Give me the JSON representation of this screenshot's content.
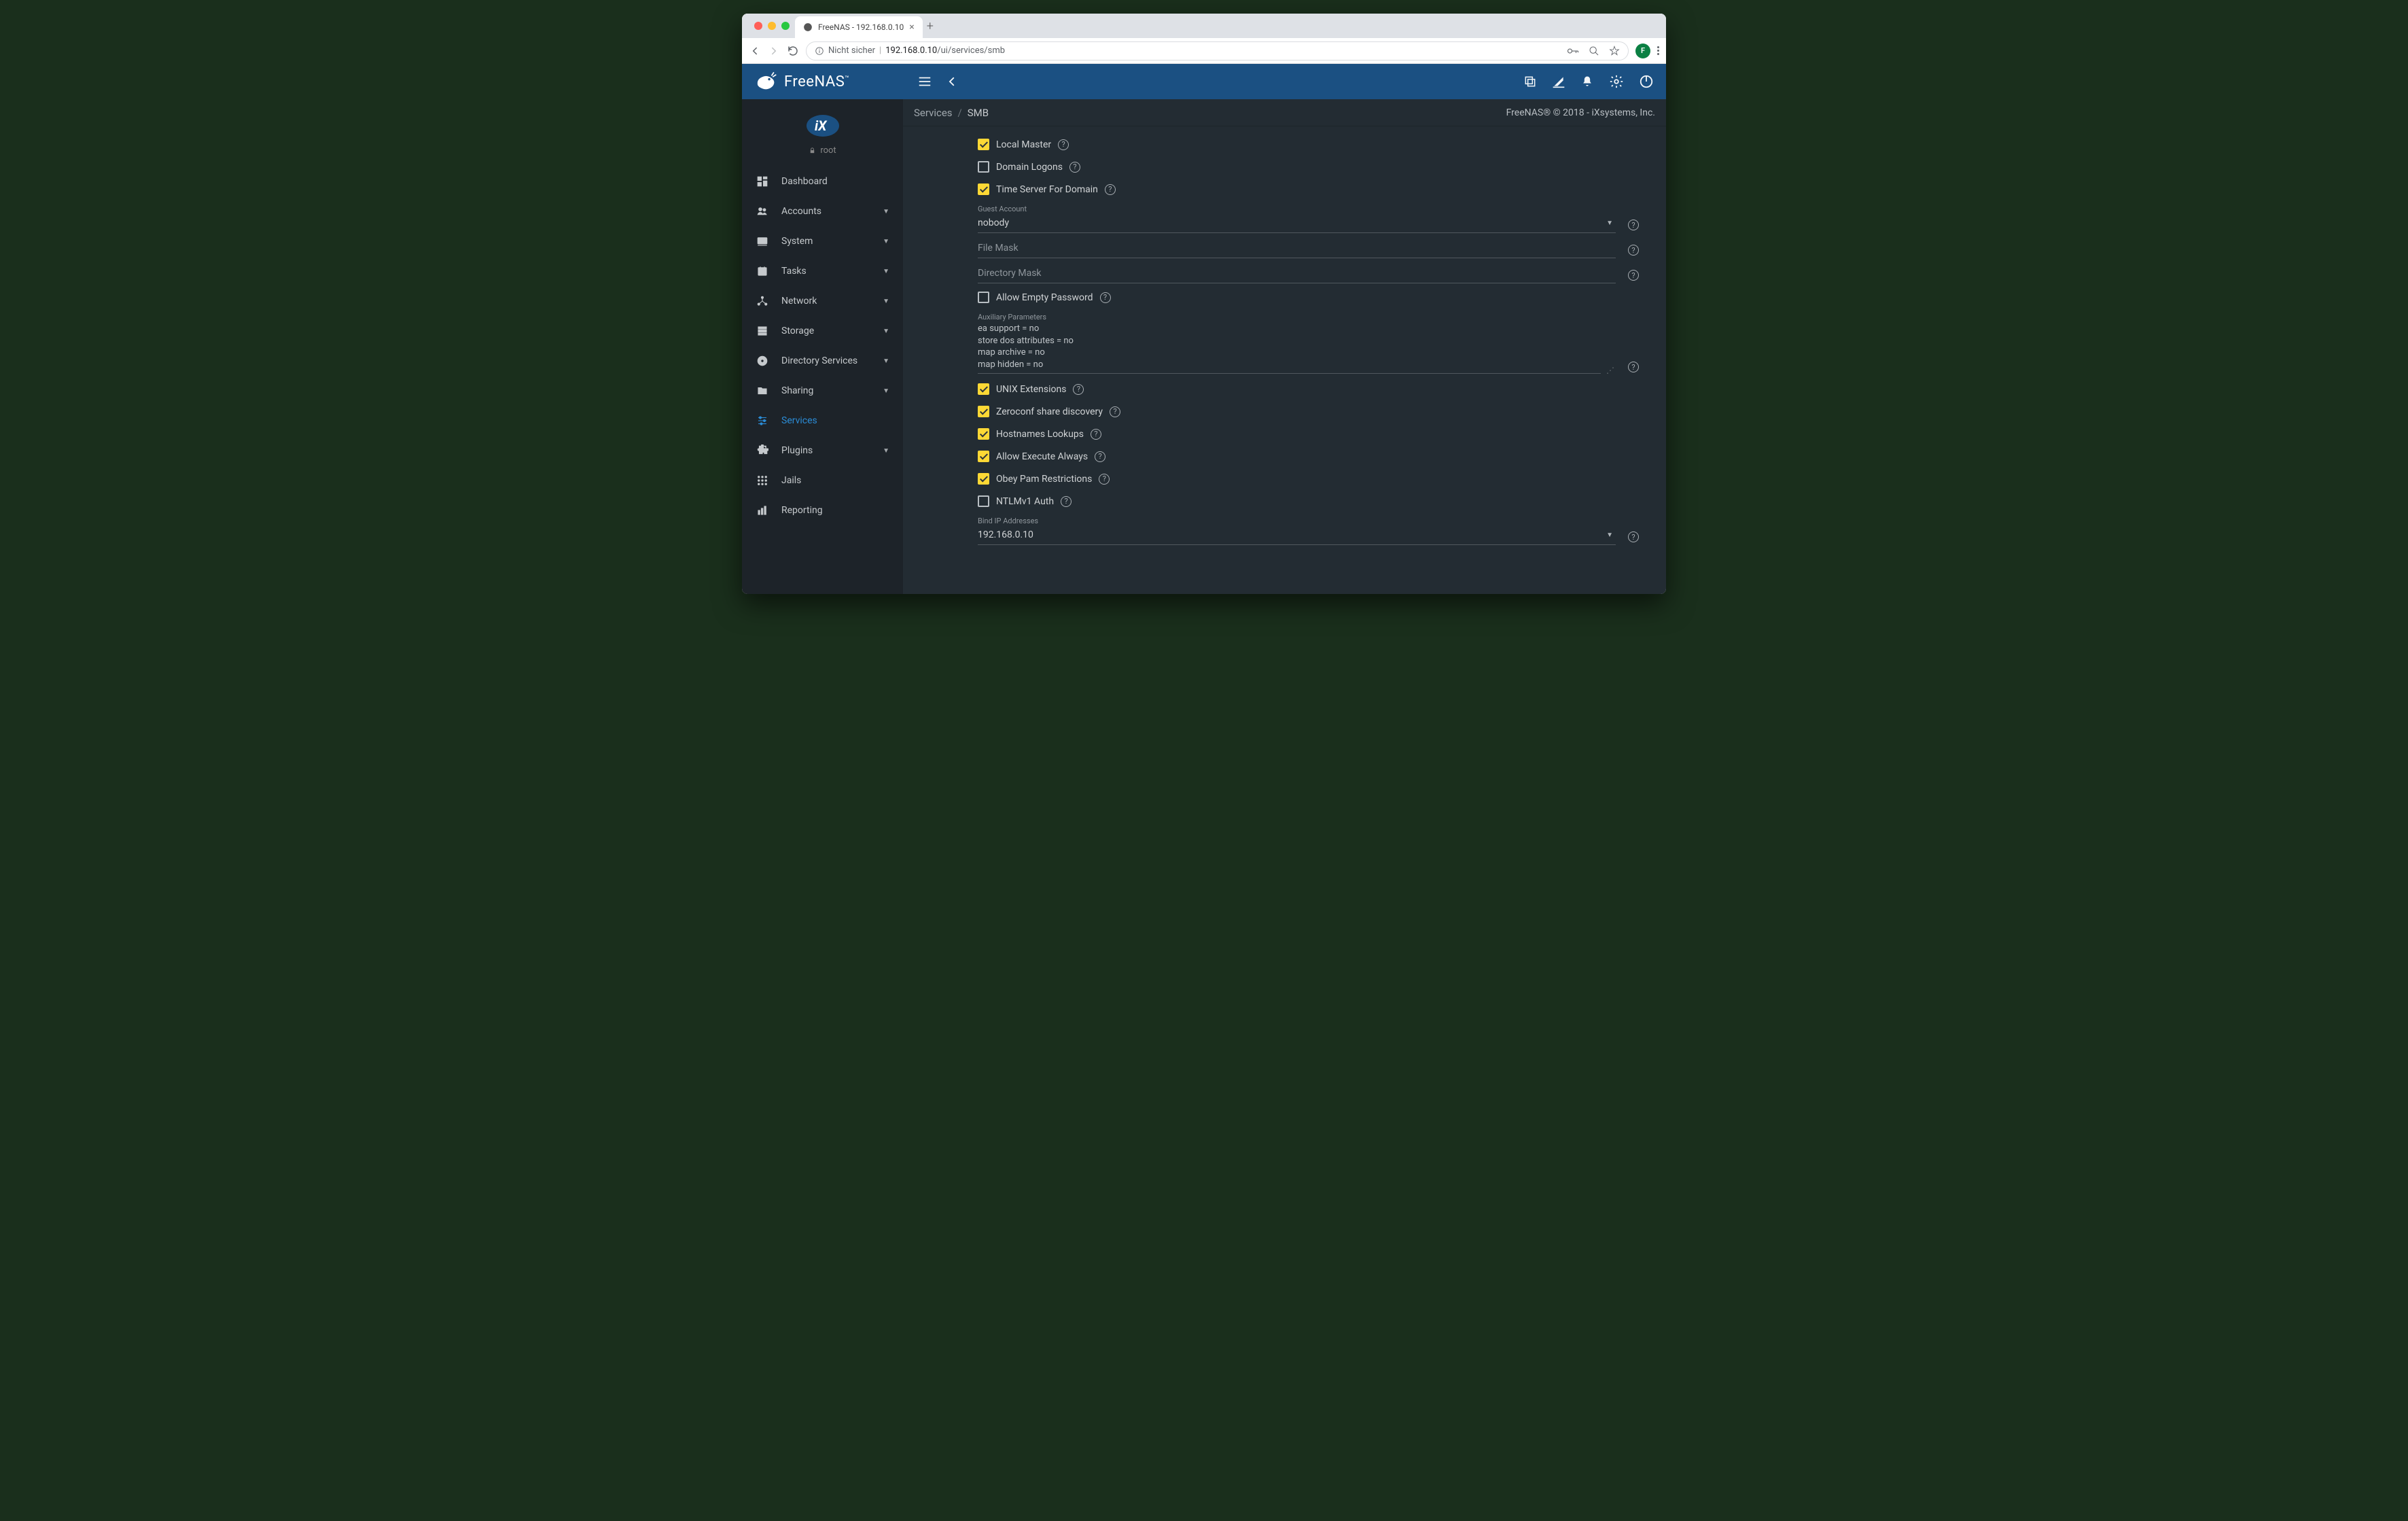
{
  "browser": {
    "tab_title": "FreeNAS - 192.168.0.10",
    "insecure_label": "Nicht sicher",
    "url_host": "192.168.0.10",
    "url_path": "/ui/services/smb",
    "avatar_letter": "F"
  },
  "header": {
    "brand": "FreeNAS"
  },
  "user": {
    "name": "root"
  },
  "sidebar": [
    {
      "icon": "dashboard",
      "label": "Dashboard",
      "expandable": false,
      "active": false
    },
    {
      "icon": "accounts",
      "label": "Accounts",
      "expandable": true,
      "active": false
    },
    {
      "icon": "system",
      "label": "System",
      "expandable": true,
      "active": false
    },
    {
      "icon": "tasks",
      "label": "Tasks",
      "expandable": true,
      "active": false
    },
    {
      "icon": "network",
      "label": "Network",
      "expandable": true,
      "active": false
    },
    {
      "icon": "storage",
      "label": "Storage",
      "expandable": true,
      "active": false
    },
    {
      "icon": "directory",
      "label": "Directory Services",
      "expandable": true,
      "active": false
    },
    {
      "icon": "sharing",
      "label": "Sharing",
      "expandable": true,
      "active": false
    },
    {
      "icon": "services",
      "label": "Services",
      "expandable": false,
      "active": true
    },
    {
      "icon": "plugins",
      "label": "Plugins",
      "expandable": true,
      "active": false
    },
    {
      "icon": "jails",
      "label": "Jails",
      "expandable": false,
      "active": false
    },
    {
      "icon": "reporting",
      "label": "Reporting",
      "expandable": false,
      "active": false
    }
  ],
  "breadcrumb": {
    "root": "Services",
    "current": "SMB"
  },
  "copyright": "FreeNAS® © 2018 - iXsystems, Inc.",
  "form": {
    "local_master": {
      "label": "Local Master",
      "checked": true
    },
    "domain_logons": {
      "label": "Domain Logons",
      "checked": false
    },
    "time_server": {
      "label": "Time Server For Domain",
      "checked": true
    },
    "guest_account": {
      "label": "Guest Account",
      "value": "nobody"
    },
    "file_mask": {
      "label": "File Mask",
      "value": ""
    },
    "directory_mask": {
      "label": "Directory Mask",
      "value": ""
    },
    "allow_empty_password": {
      "label": "Allow Empty Password",
      "checked": false
    },
    "aux_params": {
      "label": "Auxiliary Parameters",
      "lines": [
        "ea support = no",
        "store dos attributes = no",
        "map archive = no",
        "map hidden = no"
      ]
    },
    "unix_ext": {
      "label": "UNIX Extensions",
      "checked": true
    },
    "zeroconf": {
      "label": "Zeroconf share discovery",
      "checked": true
    },
    "hostnames": {
      "label": "Hostnames Lookups",
      "checked": true
    },
    "allow_exec": {
      "label": "Allow Execute Always",
      "checked": true
    },
    "obey_pam": {
      "label": "Obey Pam Restrictions",
      "checked": true
    },
    "ntlmv1": {
      "label": "NTLMv1 Auth",
      "checked": false
    },
    "bind_ip": {
      "label": "Bind IP Addresses",
      "value": "192.168.0.10"
    }
  }
}
